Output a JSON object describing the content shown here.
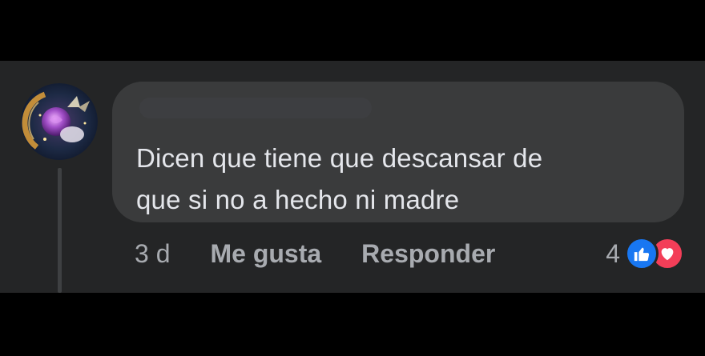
{
  "comment": {
    "text_lines": [
      "Dicen que tiene que descansar de",
      "que si no a hecho ni madre"
    ]
  },
  "actions": {
    "timestamp": "3 d",
    "like_label": "Me gusta",
    "reply_label": "Responder"
  },
  "reactions": {
    "count": "4",
    "types": [
      "like-icon",
      "love-icon"
    ],
    "like_color": "#1877f2",
    "love_color": "#f33e58"
  },
  "colors": {
    "panel_bg": "#242526",
    "bubble_bg": "#3a3b3c",
    "text": "#e4e6eb",
    "muted": "#a8abb0"
  }
}
